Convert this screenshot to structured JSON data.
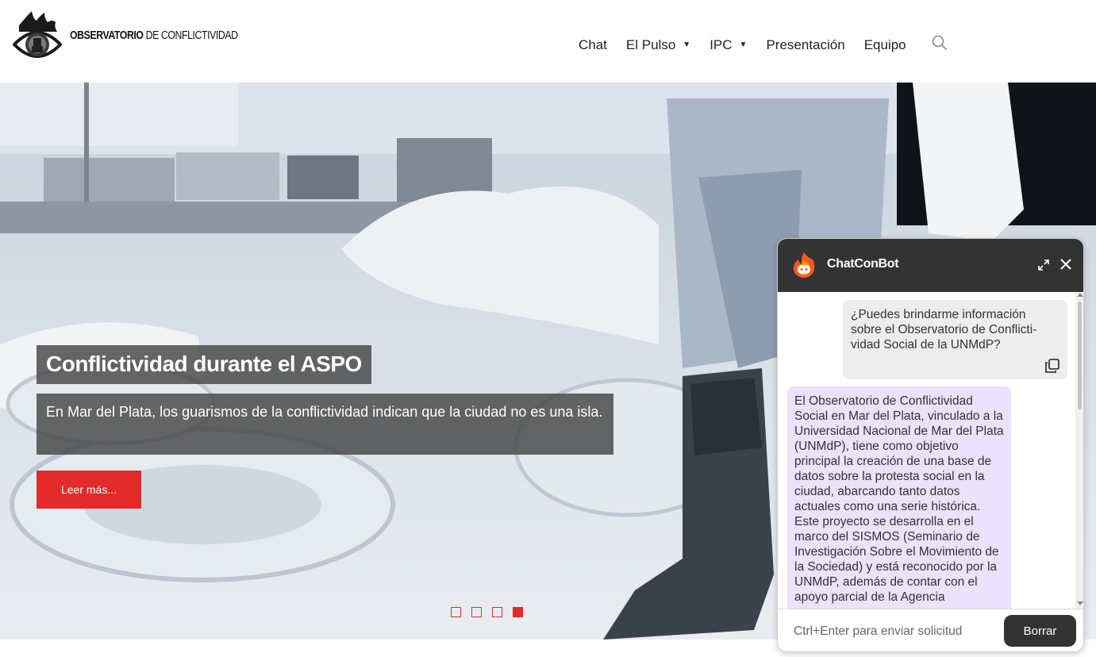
{
  "header": {
    "logo": {
      "bold": "OBSERVATORIO",
      "light": " DE CONFLICTIVIDAD",
      "icon": "eye-logo-icon"
    },
    "nav": [
      {
        "label": "Chat",
        "dropdown": false
      },
      {
        "label": "El Pulso",
        "dropdown": true
      },
      {
        "label": "IPC",
        "dropdown": true
      },
      {
        "label": "Presentación",
        "dropdown": false
      },
      {
        "label": "Equipo",
        "dropdown": false
      }
    ],
    "caret": "▼",
    "search_icon": "search-icon"
  },
  "hero": {
    "title": "Conflictividad durante el ASPO",
    "text": "En Mar del Plata, los guarismos de la conflictividad indican que la ciudad no es una isla.",
    "button_label": "Leer más...",
    "slides": 4,
    "active_slide": 4,
    "accent": "#e32b2b"
  },
  "chat": {
    "title": "ChatConBot",
    "icons": [
      "flame-logo-icon",
      "expand-icon",
      "close-icon",
      "copy-icon"
    ],
    "user_message": "¿Puedes brindarme información sobre el Observatorio de Conflicti- vidad Social de la UNMdP?",
    "bot_message": "El Observatorio de Conflictividad Social en Mar del Plata, vinculado a la Universidad Nacional de Mar del Plata (UNMdP), tiene como objetivo principal la creación de una base de datos sobre la protesta social en la ciudad, abarcando tanto datos actuales como una serie histórica. Este proyecto se desarrolla en el marco del SISMOS (Seminario de Investigación Sobre el Movimiento de la Sociedad) y está reconocido por la UNMdP, además de contar con el apoyo parcial de la Agencia",
    "input_placeholder": "Ctrl+Enter para enviar solicitud",
    "clear_label": "Borrar"
  }
}
